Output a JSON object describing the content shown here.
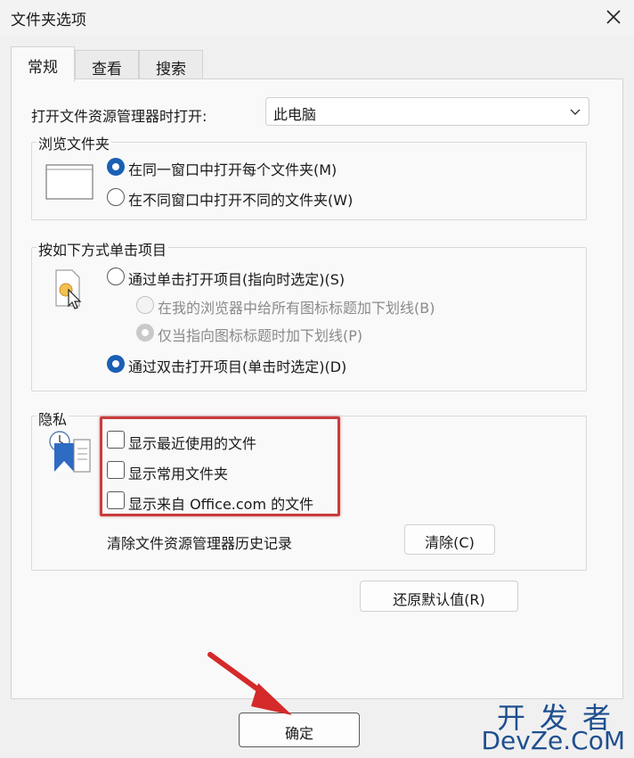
{
  "window": {
    "title": "文件夹选项"
  },
  "tabs": [
    {
      "label": "常规",
      "active": true
    },
    {
      "label": "查看",
      "active": false
    },
    {
      "label": "搜索",
      "active": false
    }
  ],
  "general": {
    "open_explorer_label": "打开文件资源管理器时打开:",
    "open_explorer_value": "此电脑",
    "browse_group": {
      "title": "浏览文件夹",
      "options": [
        {
          "label": "在同一窗口中打开每个文件夹(M)",
          "selected": true
        },
        {
          "label": "在不同窗口中打开不同的文件夹(W)",
          "selected": false
        }
      ]
    },
    "click_group": {
      "title": "按如下方式单击项目",
      "options": [
        {
          "label": "通过单击打开项目(指向时选定)(S)",
          "selected": false
        },
        {
          "label": "在我的浏览器中给所有图标标题加下划线(B)",
          "selected": false,
          "disabled": true
        },
        {
          "label": "仅当指向图标标题时加下划线(P)",
          "selected": true,
          "disabled": true
        },
        {
          "label": "通过双击打开项目(单击时选定)(D)",
          "selected": true
        }
      ]
    },
    "privacy_group": {
      "title": "隐私",
      "checkboxes": [
        {
          "label": "显示最近使用的文件",
          "checked": false
        },
        {
          "label": "显示常用文件夹",
          "checked": false
        },
        {
          "label": "显示来自 Office.com 的文件",
          "checked": false
        }
      ],
      "clear_history_label": "清除文件资源管理器历史记录",
      "clear_button": "清除(C)"
    },
    "restore_defaults_button": "还原默认值(R)"
  },
  "footer": {
    "ok_button": "确定"
  },
  "watermark": {
    "line1": "开发者",
    "line2": "DevZe.CoM"
  },
  "colors": {
    "accent": "#1a5fb4",
    "highlight_box": "#c83c3c",
    "arrow": "#d42a2a"
  }
}
